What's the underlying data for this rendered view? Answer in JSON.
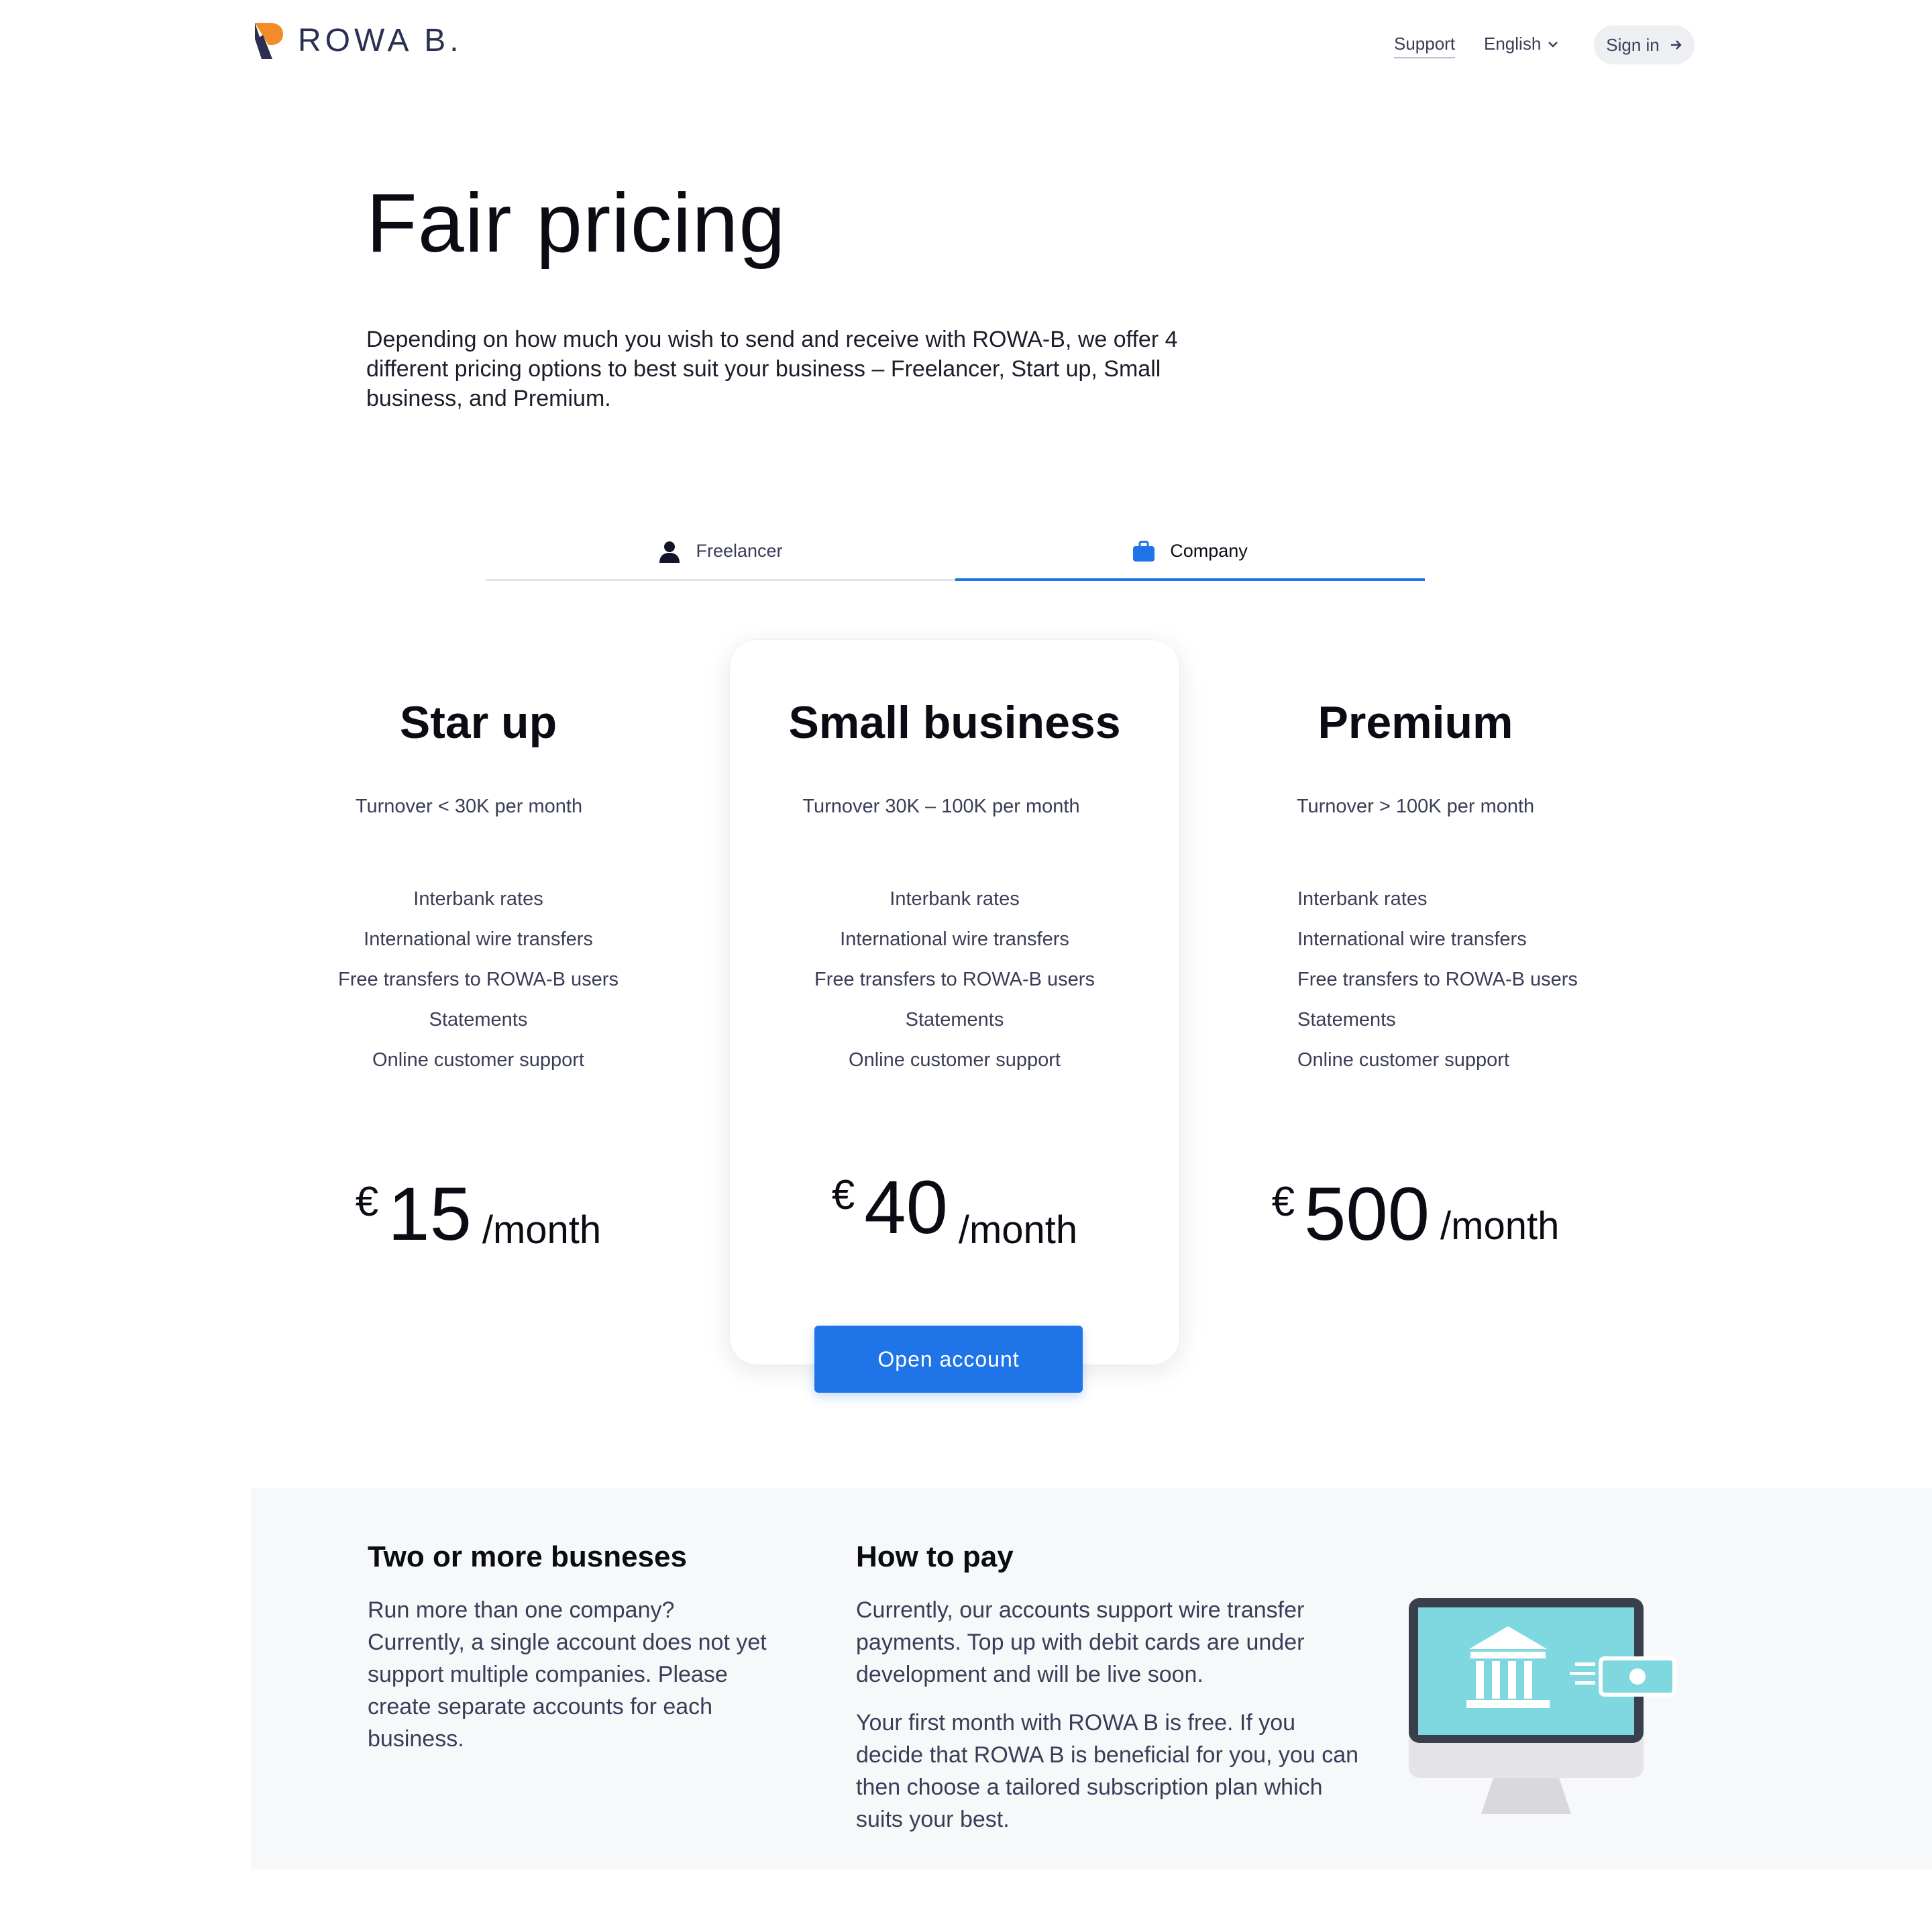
{
  "header": {
    "logo_text": "ROWA B.",
    "support": "Support",
    "language": "English",
    "signin": "Sign in"
  },
  "hero": {
    "title": "Fair pricing",
    "description": "Depending on how much you wish to send and receive with ROWA-B, we offer 4 different pricing options to best suit your business – Freelancer, Start up, Small business, and Premium."
  },
  "tabs": [
    {
      "label": "Freelancer",
      "icon": "person-icon",
      "active": false
    },
    {
      "label": "Company",
      "icon": "briefcase-icon",
      "active": true
    }
  ],
  "plans": [
    {
      "title": "Star up",
      "turnover": "Turnover < 30K per month",
      "features": [
        "Interbank rates",
        "International wire transfers",
        "Free transfers to ROWA-B users",
        "Statements",
        "Online customer support"
      ],
      "currency": "€",
      "amount": "15",
      "period": "/month"
    },
    {
      "title": "Small business",
      "turnover": "Turnover 30K – 100K per month",
      "features": [
        "Interbank rates",
        "International wire transfers",
        "Free transfers to ROWA-B users",
        "Statements",
        "Online customer support"
      ],
      "currency": "€",
      "amount": "40",
      "period": "/month",
      "cta": "Open account"
    },
    {
      "title": "Premium",
      "turnover": "Turnover > 100K per month",
      "features": [
        "Interbank rates",
        "International wire transfers",
        "Free transfers to ROWA-B users",
        "Statements",
        "Online customer support"
      ],
      "currency": "€",
      "amount": "500",
      "period": "/month"
    }
  ],
  "info": {
    "multi": {
      "title": "Two or more busneses",
      "text": "Run more than one company? Currently, a single account does not yet support multiple companies. Please create separate accounts for each business."
    },
    "pay": {
      "title": "How to pay",
      "text1": "Currently, our accounts support wire transfer payments. Top up with debit cards are under development and will be live soon.",
      "text2": "Your first month with ROWA B is free. If you decide that ROWA B is beneficial for you, you can then choose a tailored subscription plan which suits your best."
    }
  },
  "colors": {
    "accent": "#1f75e8",
    "logo_orange": "#f28c28",
    "logo_navy": "#2b2f52",
    "illustration_screen": "#7fd8e0"
  }
}
